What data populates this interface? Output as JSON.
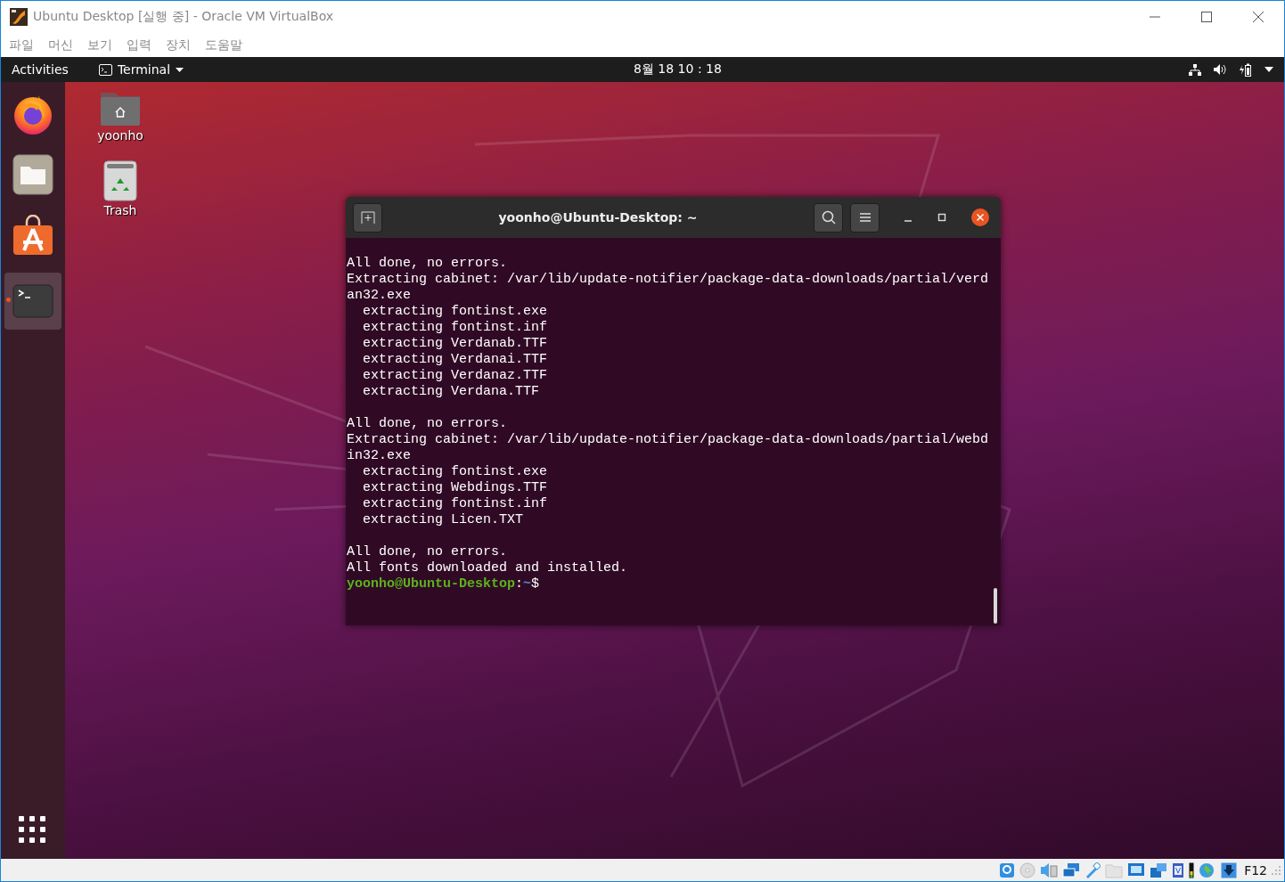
{
  "window": {
    "title": "Ubuntu Desktop [실행 중] - Oracle VM VirtualBox"
  },
  "menu_bar": [
    "파일",
    "머신",
    "보기",
    "입력",
    "장치",
    "도움말"
  ],
  "top_bar": {
    "activities": "Activities",
    "app_menu": "Terminal",
    "clock": "8월 18  10 : 18"
  },
  "dock": [
    {
      "kind": "firefox",
      "running": false,
      "focused": false
    },
    {
      "kind": "files",
      "running": false,
      "focused": false
    },
    {
      "kind": "software",
      "running": false,
      "focused": false
    },
    {
      "kind": "terminal",
      "running": true,
      "focused": true
    }
  ],
  "desktop_icons": [
    {
      "kind": "home",
      "label": "yoonho"
    },
    {
      "kind": "trash",
      "label": "Trash"
    }
  ],
  "terminal": {
    "title": "yoonho@Ubuntu-Desktop: ~",
    "lines": [
      {
        "kind": "blank"
      },
      {
        "kind": "output",
        "text": "All done, no errors."
      },
      {
        "kind": "output",
        "text": "Extracting cabinet: /var/lib/update-notifier/package-data-downloads/partial/verd"
      },
      {
        "kind": "output",
        "text": "an32.exe"
      },
      {
        "kind": "output",
        "text": "  extracting fontinst.exe"
      },
      {
        "kind": "output",
        "text": "  extracting fontinst.inf"
      },
      {
        "kind": "output",
        "text": "  extracting Verdanab.TTF"
      },
      {
        "kind": "output",
        "text": "  extracting Verdanai.TTF"
      },
      {
        "kind": "output",
        "text": "  extracting Verdanaz.TTF"
      },
      {
        "kind": "output",
        "text": "  extracting Verdana.TTF"
      },
      {
        "kind": "blank"
      },
      {
        "kind": "output",
        "text": "All done, no errors."
      },
      {
        "kind": "output",
        "text": "Extracting cabinet: /var/lib/update-notifier/package-data-downloads/partial/webd"
      },
      {
        "kind": "output",
        "text": "in32.exe"
      },
      {
        "kind": "output",
        "text": "  extracting fontinst.exe"
      },
      {
        "kind": "output",
        "text": "  extracting Webdings.TTF"
      },
      {
        "kind": "output",
        "text": "  extracting fontinst.inf"
      },
      {
        "kind": "output",
        "text": "  extracting Licen.TXT"
      },
      {
        "kind": "blank"
      },
      {
        "kind": "output",
        "text": "All done, no errors."
      },
      {
        "kind": "output",
        "text": "All fonts downloaded and installed."
      },
      {
        "kind": "prompt",
        "user_host": "yoonho@Ubuntu-Desktop",
        "separator": ":",
        "path": "~",
        "symbol": "$"
      }
    ]
  },
  "status_bar": {
    "host_key": "F12"
  }
}
